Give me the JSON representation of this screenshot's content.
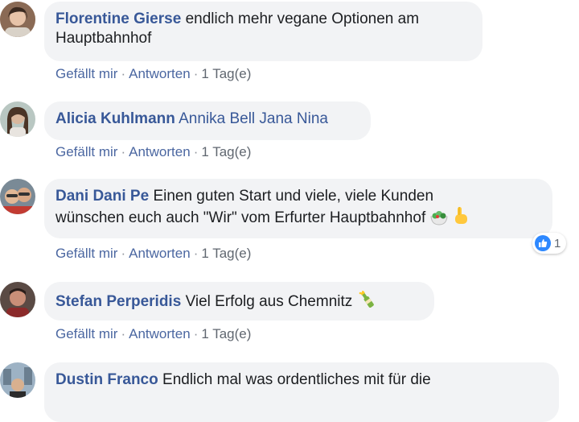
{
  "comments": [
    {
      "author": "Florentine Gierse",
      "text": "endlich mehr vegane Optionen am",
      "text2": "Hauptbahnhof",
      "actions": {
        "like": "Gefällt mir",
        "reply": "Antworten",
        "time": "1 Tag(e)",
        "sep": "·"
      }
    },
    {
      "author": "Alicia Kuhlmann",
      "tags": "Annika Bell Jana Nina",
      "actions": {
        "like": "Gefällt mir",
        "reply": "Antworten",
        "time": "1 Tag(e)",
        "sep": "·"
      }
    },
    {
      "author": "Dani Dani Pe",
      "text": "Einen guten Start und viele, viele Kunden",
      "text2": "wünschen euch auch \"Wir\" vom Erfurter Hauptbahnhof",
      "emojis": [
        "salad-emoji",
        "pointing-up-hand-emoji"
      ],
      "reaction_count": "1",
      "actions": {
        "like": "Gefällt mir",
        "reply": "Antworten",
        "time": "1 Tag(e)",
        "sep": "·"
      }
    },
    {
      "author": "Stefan Perperidis",
      "text": "Viel Erfolg aus Chemnitz",
      "emojis": [
        "champagne-emoji"
      ],
      "actions": {
        "like": "Gefällt mir",
        "reply": "Antworten",
        "time": "1 Tag(e)",
        "sep": "·"
      }
    },
    {
      "author": "Dustin Franco",
      "text": "Endlich mal was ordentliches mit für die"
    }
  ],
  "colors": {
    "author": "#385898",
    "bubble": "#f2f3f5",
    "like_blue": "#2d88ff"
  }
}
